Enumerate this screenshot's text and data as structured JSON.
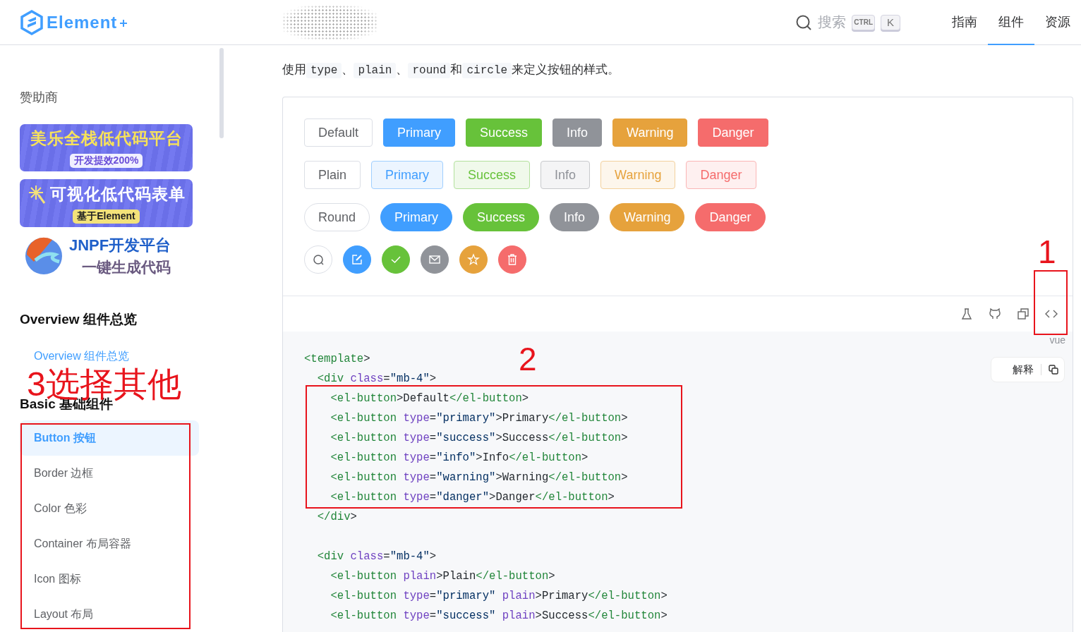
{
  "header": {
    "logo": "Element",
    "search": {
      "placeholder": "搜索",
      "keys": [
        "CTRL",
        "K"
      ]
    },
    "tabs": [
      {
        "label": "指南",
        "selected": false
      },
      {
        "label": "组件",
        "selected": true
      },
      {
        "label": "资源",
        "selected": false
      }
    ]
  },
  "sidebar": {
    "sponsor_title": "赞助商",
    "sponsors": [
      {
        "kind": "banner",
        "title": "美乐全栈低代码平台",
        "tag": "开发提效200%"
      },
      {
        "kind": "wand",
        "title": "可视化低代码表单",
        "tag": "基于Element"
      },
      {
        "kind": "logo",
        "title": "JNPF开发平台",
        "tag": "一键生成代码"
      }
    ],
    "groups": [
      {
        "title": "Overview 组件总览",
        "items": [
          {
            "label": "Overview 组件总览",
            "selected": false
          }
        ]
      },
      {
        "title": "Basic 基础组件",
        "items": [
          {
            "label": "Button 按钮",
            "selected": true
          },
          {
            "label": "Border 边框",
            "selected": false
          },
          {
            "label": "Color 色彩",
            "selected": false
          },
          {
            "label": "Container 布局容器",
            "selected": false
          },
          {
            "label": "Icon 图标",
            "selected": false
          },
          {
            "label": "Layout 布局",
            "selected": false
          }
        ]
      }
    ]
  },
  "intro": [
    "使用",
    "type",
    "、",
    "plain",
    "、",
    "round",
    "和",
    "circle",
    "来定义按钮的样式。"
  ],
  "demo": {
    "rows": [
      {
        "kind": "solid",
        "buttons": [
          {
            "label": "Default",
            "kind": "default"
          },
          {
            "label": "Primary",
            "kind": "primary"
          },
          {
            "label": "Success",
            "kind": "success"
          },
          {
            "label": "Info",
            "kind": "info"
          },
          {
            "label": "Warning",
            "kind": "warning"
          },
          {
            "label": "Danger",
            "kind": "danger"
          }
        ]
      },
      {
        "kind": "plain",
        "buttons": [
          {
            "label": "Plain",
            "kind": "default"
          },
          {
            "label": "Primary",
            "kind": "primary"
          },
          {
            "label": "Success",
            "kind": "success"
          },
          {
            "label": "Info",
            "kind": "info"
          },
          {
            "label": "Warning",
            "kind": "warning"
          },
          {
            "label": "Danger",
            "kind": "danger"
          }
        ]
      },
      {
        "kind": "round",
        "buttons": [
          {
            "label": "Round",
            "kind": "default"
          },
          {
            "label": "Primary",
            "kind": "primary"
          },
          {
            "label": "Success",
            "kind": "success"
          },
          {
            "label": "Info",
            "kind": "info"
          },
          {
            "label": "Warning",
            "kind": "warning"
          },
          {
            "label": "Danger",
            "kind": "danger"
          }
        ]
      },
      {
        "kind": "circle",
        "buttons": [
          {
            "kind": "default"
          },
          {
            "kind": "primary"
          },
          {
            "kind": "success"
          },
          {
            "kind": "info"
          },
          {
            "kind": "warning"
          },
          {
            "kind": "danger"
          }
        ]
      }
    ],
    "lang": "vue",
    "explain": "解释",
    "code": [
      [
        "<template>",
        "  <div class=\"mb-4\">",
        "    <el-button>Default</el-button>",
        "    <el-button type=\"primary\">Primary</el-button>",
        "    <el-button type=\"success\">Success</el-button>",
        "    <el-button type=\"info\">Info</el-button>",
        "    <el-button type=\"warning\">Warning</el-button>",
        "    <el-button type=\"danger\">Danger</el-button>",
        "  </div>"
      ],
      [
        "  <div class=\"mb-4\">",
        "    <el-button plain>Plain</el-button>",
        "    <el-button type=\"primary\" plain>Primary</el-button>",
        "    <el-button type=\"success\" plain>Success</el-button>"
      ]
    ]
  },
  "annotations": [
    {
      "label": "1",
      "framed": true
    },
    {
      "label": "2",
      "framed": true
    },
    {
      "label": "3选择其他",
      "framed": true
    }
  ]
}
